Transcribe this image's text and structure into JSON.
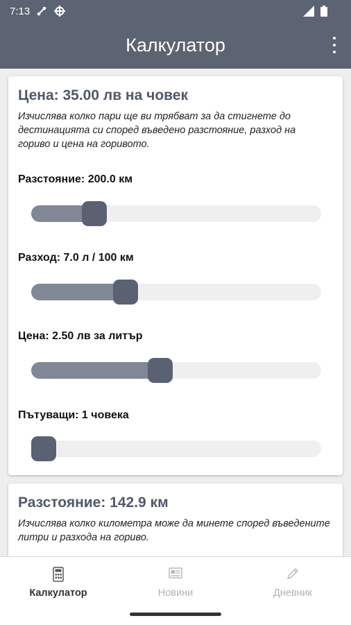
{
  "status": {
    "time": "7:13",
    "left_icons": [
      "share-icon",
      "crosshair-icon"
    ],
    "right_icons": [
      "signal-icon",
      "battery-icon"
    ]
  },
  "app_bar": {
    "title": "Калкулатор",
    "menu_icon": "more-vert-icon"
  },
  "card1": {
    "title": "Цена: 35.00 лв на човек",
    "description": "Изчислява колко пари ще ви трябват за да стигнете до дестинацията си според въведено разстояние, разход на гориво и цена на горивото.",
    "sliders": [
      {
        "label": "Разстояние: 200.0 км",
        "level": 0.19
      },
      {
        "label": "Разход: 7.0 л / 100 км",
        "level": 0.31
      },
      {
        "label": "Цена: 2.50 лв за литър",
        "level": 0.44
      },
      {
        "label": "Пътуващи: 1 човека",
        "level": 0.0
      }
    ]
  },
  "card2": {
    "title": "Разстояние: 142.9 км",
    "description": "Изчислява колко километра може да минете според въведените литри и разхода на гориво."
  },
  "bottom_nav": [
    {
      "label": "Калкулатор",
      "icon": "calculator-icon",
      "active": true
    },
    {
      "label": "Новини",
      "icon": "newspaper-icon",
      "active": false
    },
    {
      "label": "Дневник",
      "icon": "pencil-icon",
      "active": false
    }
  ],
  "colors": {
    "app_bar": "#5c6373",
    "title_text": "#505869",
    "slider_fill": "#808896",
    "slider_thumb": "#5a6172",
    "slider_track": "#efefef"
  }
}
